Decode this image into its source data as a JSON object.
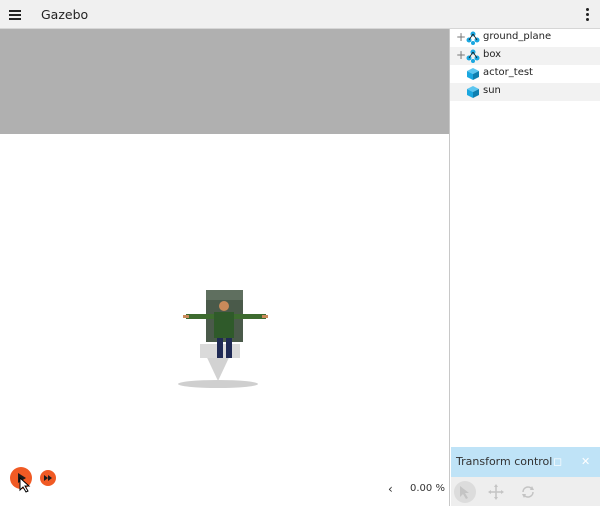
{
  "app": {
    "title": "Gazebo"
  },
  "entity_tree": {
    "items": [
      {
        "label": "ground_plane",
        "expandable": true,
        "icon": "model-icon"
      },
      {
        "label": "box",
        "expandable": true,
        "icon": "model-icon"
      },
      {
        "label": "actor_test",
        "expandable": false,
        "icon": "actor-cube-icon"
      },
      {
        "label": "sun",
        "expandable": false,
        "icon": "light-cube-icon"
      }
    ],
    "expander_symbol": "+"
  },
  "playback": {
    "rtf_value": "0.00 %",
    "chevron": "‹"
  },
  "transform_control": {
    "title": "Transform control",
    "close_symbol": "✕",
    "float_symbol": "◻"
  },
  "colors": {
    "accent": "#f05a24",
    "sky": "#b0b0b0",
    "panel_header": "#bfe3f7",
    "entity_icon": "#1aa7e0"
  }
}
